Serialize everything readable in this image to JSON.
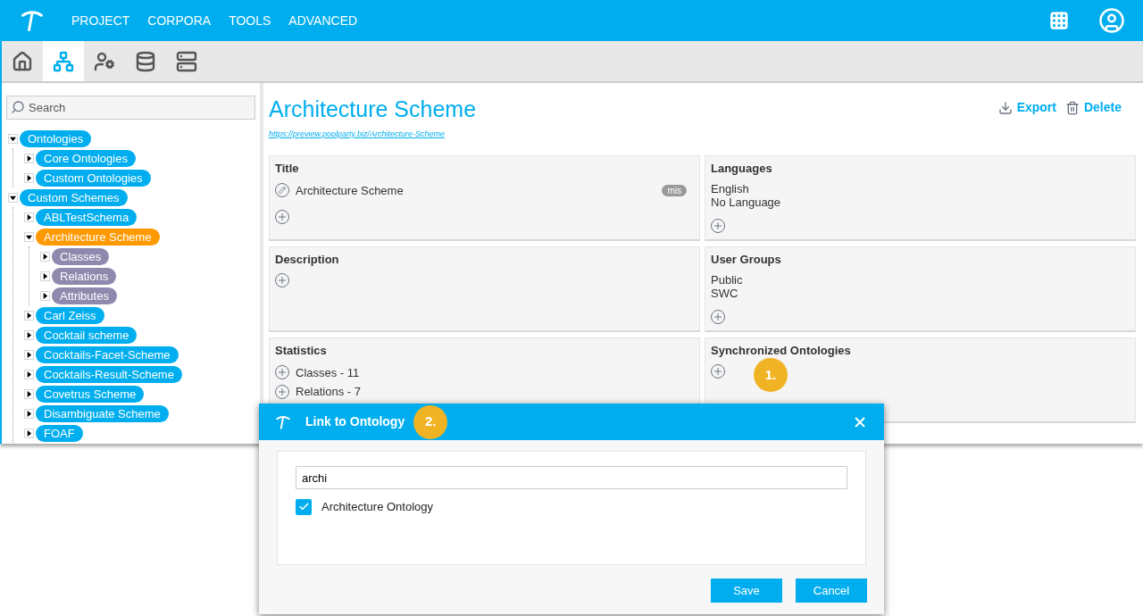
{
  "nav": {
    "menu": [
      "PROJECT",
      "CORPORA",
      "TOOLS",
      "ADVANCED"
    ]
  },
  "toolbar": [
    {
      "selected": false
    },
    {
      "selected": true
    },
    {
      "selected": false
    },
    {
      "selected": false
    },
    {
      "selected": false
    }
  ],
  "sidebar": {
    "search": {
      "placeholder": "Search"
    },
    "tree": [
      {
        "label": "Ontologies",
        "kind": "node",
        "selected": false,
        "expanded": true,
        "children": [
          {
            "label": "Core Ontologies",
            "kind": "node",
            "selected": false,
            "expanded": false
          },
          {
            "label": "Custom Ontologies",
            "kind": "node",
            "selected": false,
            "expanded": false
          }
        ]
      },
      {
        "label": "Custom Schemes",
        "kind": "node",
        "selected": false,
        "expanded": true,
        "children": [
          {
            "label": "ABLTestSchema",
            "kind": "node",
            "selected": false,
            "expanded": false
          },
          {
            "label": "Architecture Scheme",
            "kind": "node",
            "selected": true,
            "expanded": true,
            "children": [
              {
                "label": "Classes",
                "kind": "group",
                "selected": false,
                "expanded": false
              },
              {
                "label": "Relations",
                "kind": "group",
                "selected": false,
                "expanded": false
              },
              {
                "label": "Attributes",
                "kind": "group",
                "selected": false,
                "expanded": false
              }
            ]
          },
          {
            "label": "Carl Zeiss",
            "kind": "node",
            "selected": false,
            "expanded": false
          },
          {
            "label": "Cocktail scheme",
            "kind": "node",
            "selected": false,
            "expanded": false
          },
          {
            "label": "Cocktails-Facet-Scheme",
            "kind": "node",
            "selected": false,
            "expanded": false
          },
          {
            "label": "Cocktails-Result-Scheme",
            "kind": "node",
            "selected": false,
            "expanded": false
          },
          {
            "label": "Covetrus Scheme",
            "kind": "node",
            "selected": false,
            "expanded": false
          },
          {
            "label": "Disambiguate Scheme",
            "kind": "node",
            "selected": false,
            "expanded": false
          },
          {
            "label": "FOAF",
            "kind": "node",
            "selected": false,
            "expanded": false
          }
        ]
      }
    ]
  },
  "page": {
    "title": "Architecture Scheme",
    "url": "https://preview.poolparty.biz/Architecture-Scheme",
    "actions": [
      "Export",
      "Delete"
    ],
    "cards": [
      {
        "title": "Title",
        "kind": "labels",
        "items": [
          {
            "text": "Architecture Scheme",
            "tag": "mis"
          }
        ]
      },
      {
        "title": "Languages",
        "kind": "list",
        "items": [
          {
            "text": "English"
          },
          {
            "text": "No Language"
          }
        ]
      },
      {
        "title": "Description",
        "kind": "list"
      },
      {
        "title": "User Groups",
        "kind": "list",
        "items": [
          {
            "text": "Public"
          },
          {
            "text": "SWC"
          }
        ]
      },
      {
        "title": "Statistics",
        "kind": "stats",
        "items": [
          {
            "text": "Classes - 11"
          },
          {
            "text": "Relations - 7"
          }
        ]
      },
      {
        "title": "Synchronized Ontologies",
        "kind": "list",
        "marker": "1."
      }
    ]
  },
  "dialog": {
    "title": "Link to Ontology",
    "marker": "2.",
    "search": {
      "value": "archi"
    },
    "options": [
      {
        "label": "Architecture Ontology",
        "checked": true
      }
    ],
    "buttons": [
      "Save",
      "Cancel"
    ]
  }
}
